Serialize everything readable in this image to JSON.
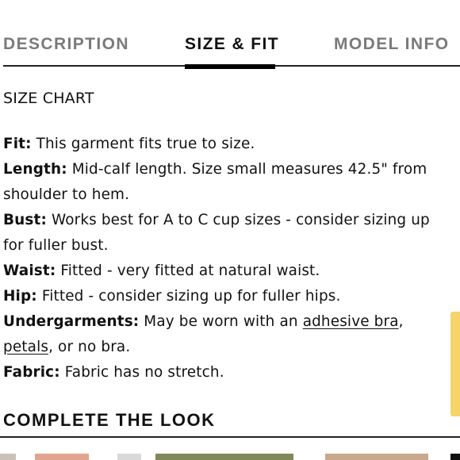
{
  "tabs": [
    {
      "label": "DESCRIPTION",
      "active": false
    },
    {
      "label": "SIZE & FIT",
      "active": true
    },
    {
      "label": "MODEL INFO",
      "active": false
    }
  ],
  "size_chart_link": "SIZE CHART",
  "specs": {
    "fit": {
      "label": "Fit:",
      "text": " This garment fits true to size."
    },
    "length": {
      "label": "Length:",
      "text_line1": " Mid-calf length. Size small measures 42.5\" from",
      "text_line2": "shoulder to hem."
    },
    "bust": {
      "label": "Bust:",
      "text_line1": " Works best for A to C cup sizes - consider sizing up",
      "text_line2": "for fuller bust."
    },
    "waist": {
      "label": "Waist:",
      "text": " Fitted - very fitted at natural waist."
    },
    "hip": {
      "label": "Hip:",
      "text": " Fitted - consider sizing up for fuller hips."
    },
    "undergarments": {
      "label": "Undergarments:",
      "text_before": " May be worn with an ",
      "link1": "adhesive bra",
      "text_mid": ",",
      "link2": "petals",
      "text_after": ", or no bra."
    },
    "fabric": {
      "label": "Fabric:",
      "text": " Fabric has no stretch."
    }
  },
  "section_title": "COMPLETE THE LOOK",
  "colors": {
    "accent": "#000000",
    "inactive_tab": "#7a7a7a",
    "side_tab": "#f5d46a"
  }
}
